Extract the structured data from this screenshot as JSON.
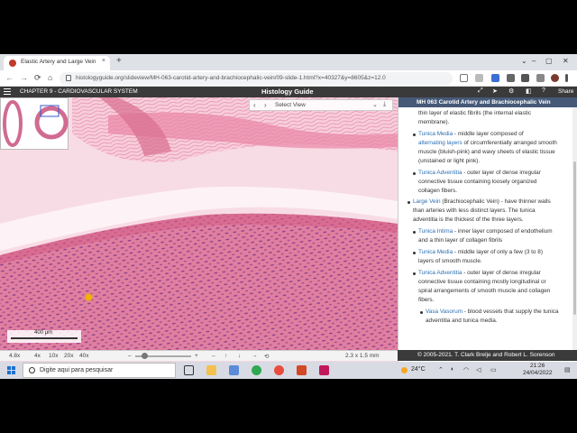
{
  "browser": {
    "tab_title": "Elastic Artery and Large Vein",
    "tab_close": "×",
    "new_tab": "+",
    "url": "histologyguide.org/slideview/MH-063-carotid-artery-and-brachiocephalic-vein/09-slide-1.html?x=40327&y=8605&z=12.0",
    "window_controls": [
      "⌄",
      "–",
      "▢",
      "✕"
    ],
    "nav": [
      "←",
      "→",
      "⟳",
      "⌂"
    ]
  },
  "site": {
    "chapter": "CHAPTER 9 - CARDIOVASCULAR SYSTEM",
    "title": "Histology Guide",
    "share": "Share"
  },
  "viewer": {
    "select_view": "Select View",
    "nav_prev": "‹",
    "nav_next": "›",
    "scale_label": "400 µm"
  },
  "toolbar": {
    "zoom": "4.8x",
    "magnifications": [
      "4x",
      "10x",
      "20x",
      "40x"
    ],
    "minus": "–",
    "plus": "+",
    "arrows": [
      "←",
      "↑",
      "↓",
      "→"
    ],
    "dimensions": "2.3 x 1.5 mm"
  },
  "sidebar": {
    "title": "MH 063 Carotid Artery and Brachiocephalic Vein",
    "line0": "thin layer of elastic fibrils (the internal elastic",
    "line1": "membrane).",
    "tm_link": "Tunica Media",
    "tm_text1": " - middle layer composed of",
    "tm_link2": "alternating layers",
    "tm_text2": " of circumferentially arranged smooth",
    "tm_text3": "muscle (bluish-pink) and wavy sheets of elastic tissue",
    "tm_text4": "(unstained or light pink).",
    "ta_link": "Tunica Adventitia",
    "ta_text1": " - outer layer of dense irregular",
    "ta_text2": "connective tissue containing loosely organized",
    "ta_text3": "collagen fibers.",
    "lv_link": "Large Vein",
    "lv_text1": " (Brachiocephalic Vein) - have thinner walls",
    "lv_text2": "than arteries with less distinct layers. The tunica",
    "lv_text3": "adventitia is the thickest of the three layers.",
    "ti_link": "Tunica Intima",
    "ti_text1": " - inner layer composed of endothelium",
    "ti_text2": "and a thin layer of collagen fibrils",
    "vm_link": "Tunica Media",
    "vm_text1": " - middle layer of only a few (3 to 8)",
    "vm_text2": "layers of smooth muscle.",
    "va_link": "Tunica Adventitia",
    "va_text1": " - outer layer of dense irregular",
    "va_text2": "connective tissue containing mostly longitudinal or",
    "va_text3": "spiral arrangements of smooth muscle and collagen",
    "va_text4": "fibers.",
    "vv_link": "Vasa Vasorum",
    "vv_text1": " - blood vessels that supply the tunica",
    "vv_text2": "adventitia and tunica media.",
    "copyright": "© 2005-2021. T. Clark Brelje and Robert L. Sorenson"
  },
  "taskbar": {
    "search_placeholder": "Digite aqui para pesquisar",
    "weather": "24°C",
    "time": "21:26",
    "date": "24/04/2022"
  },
  "colors": {
    "tissue": "#e98aa8",
    "header": "#3a3a3a",
    "sidebar_head": "#465a78",
    "link": "#2d6fb3"
  }
}
